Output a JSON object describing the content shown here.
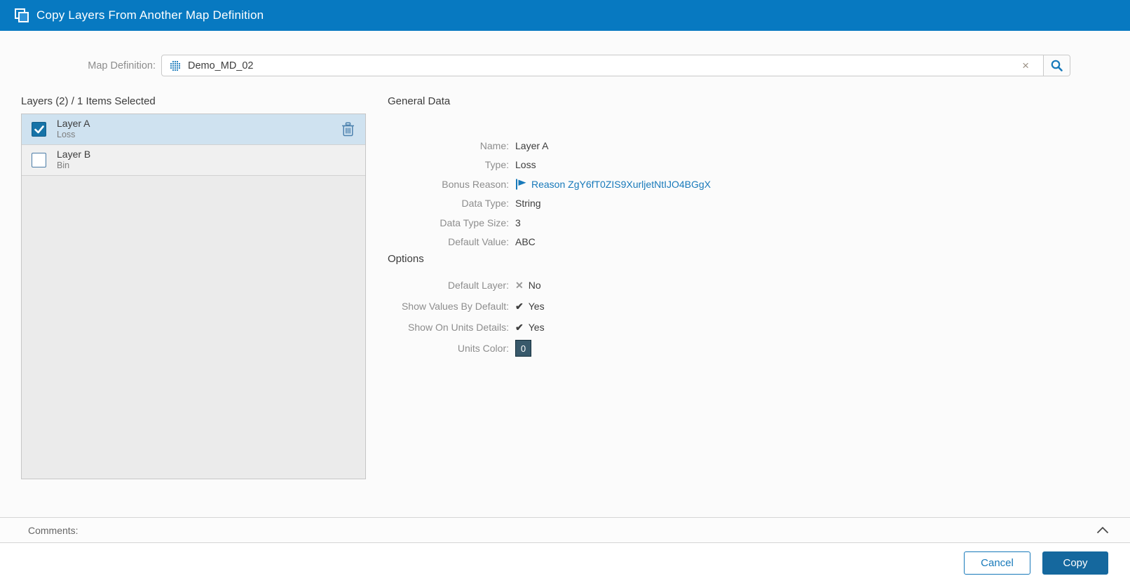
{
  "header": {
    "title": "Copy Layers From Another Map Definition"
  },
  "map_definition": {
    "label": "Map Definition:",
    "value": "Demo_MD_02",
    "clear_glyph": "×"
  },
  "layers_panel": {
    "header": "Layers (2) / 1 Items Selected",
    "items": [
      {
        "name": "Layer A",
        "type": "Loss",
        "checked": true,
        "selected": true
      },
      {
        "name": "Layer B",
        "type": "Bin",
        "checked": false,
        "selected": false
      }
    ]
  },
  "general_data": {
    "title": "General Data",
    "fields": [
      {
        "label": "Name:",
        "value": "Layer A"
      },
      {
        "label": "Type:",
        "value": "Loss"
      },
      {
        "label": "Bonus Reason:",
        "value": "Reason ZgY6fT0ZIS9XurljetNtIJO4BGgX"
      },
      {
        "label": "Data Type:",
        "value": "String"
      },
      {
        "label": "Data Type Size:",
        "value": "3"
      },
      {
        "label": "Default Value:",
        "value": "ABC"
      }
    ]
  },
  "options": {
    "title": "Options",
    "fields": [
      {
        "label": "Default Layer:",
        "value": "No",
        "mark": "✕"
      },
      {
        "label": "Show Values By Default:",
        "value": "Yes",
        "mark": "✔"
      },
      {
        "label": "Show On Units Details:",
        "value": "Yes",
        "mark": "✔"
      },
      {
        "label": "Units Color:",
        "value": "0"
      }
    ]
  },
  "comments": {
    "label": "Comments:"
  },
  "footer": {
    "cancel_label": "Cancel",
    "copy_label": "Copy"
  },
  "colors": {
    "titlebar": "#0779c1",
    "accent": "#1779ba",
    "checkbox": "#1673a8",
    "selected_row": "#cfe2f0",
    "copy_button": "#15689e",
    "units_color_badge": "#38596b"
  }
}
